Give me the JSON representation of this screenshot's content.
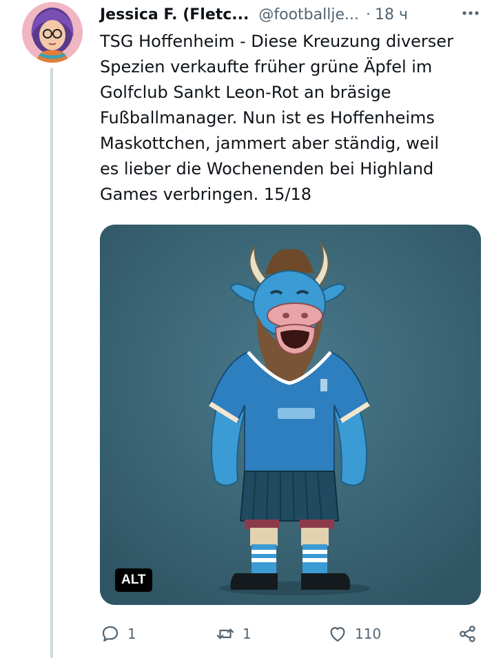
{
  "tweet": {
    "author_name": "Jessica F. (Fletc...",
    "author_handle": "@footballje...",
    "separator": "·",
    "time": "18 ч",
    "more_label": "···",
    "text": "TSG Hoffenheim - Diese Kreuzung diverser\nSpezien verkaufte früher grüne Äpfel im\nGolfclub Sankt Leon-Rot an bräsige\nFußballmanager. Nun ist es Hoffenheims\nMaskottchen, jammert aber ständig, weil\nes lieber die Wochenenden bei Highland\nGames verbringen. 15/18",
    "media": {
      "alt_badge": "ALT",
      "background_color": "#3d6878"
    }
  },
  "actions": {
    "reply_count": "1",
    "retweet_count": "1",
    "like_count": "110"
  },
  "colors": {
    "secondary_text": "#536471",
    "thread_line": "#cfd9de"
  }
}
